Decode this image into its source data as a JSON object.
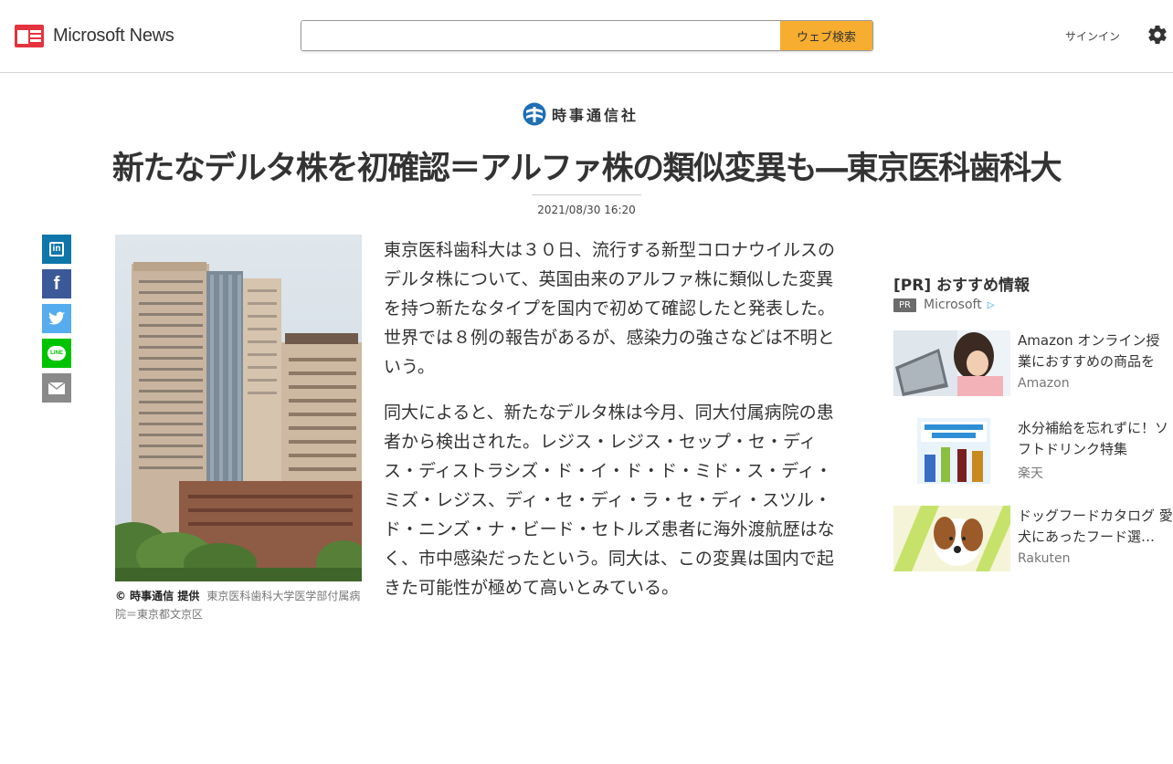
{
  "header": {
    "brand": "Microsoft News",
    "search_placeholder": "",
    "search_button": "ウェブ検索",
    "signin": "サインイン",
    "settings_icon": "gear-icon",
    "accent": "#f7ad2f"
  },
  "article": {
    "source": "時事通信社",
    "title": "新たなデルタ株を初確認＝アルファ株の類似変異も―東京医科歯科大",
    "datetime": "2021/08/30 16:20",
    "image_credit": "© 時事通信 提供",
    "image_caption": "東京医科歯科大学医学部付属病院＝東京都文京区",
    "paragraphs": [
      "東京医科歯科大は３０日、流行する新型コロナウイルスのデルタ株について、英国由来のアルファ株に類似した変異を持つ新たなタイプを国内で初めて確認したと発表した。世界では８例の報告があるが、感染力の強さなどは不明という。",
      "同大によると、新たなデルタ株は今月、同大付属病院の患者から検出された。レジス・レジス・セップ・セ・ディス・ディストラシズ・ド・イ・ド・ド・ミド・ス・ディ・ミズ・レジス、ディ・セ・ディ・ラ・セ・ディ・スツル・ド・ニンズ・ナ・ビード・セトルズ患者に海外渡航歴はなく、市中感染だったという。同大は、この変異は国内で起きた可能性が極めて高いとみている。"
    ]
  },
  "share": [
    {
      "name": "linkedin",
      "glyph": "in",
      "color": "#0e76a8"
    },
    {
      "name": "facebook",
      "glyph": "f",
      "color": "#3b5998"
    },
    {
      "name": "twitter",
      "glyph": "t",
      "color": "#55acee"
    },
    {
      "name": "line",
      "glyph": "LINE",
      "color": "#00c300"
    },
    {
      "name": "mail",
      "glyph": "✉",
      "color": "#8a8a8a"
    }
  ],
  "sidebar": {
    "heading": "[PR] おすすめ情報",
    "badge": "PR",
    "sponsor": "Microsoft",
    "items": [
      {
        "title": "Amazon オンライン授業におすすめの商品をチ…",
        "source": "Amazon"
      },
      {
        "title": "水分補給を忘れずに！ソフトドリンク特集",
        "source": "楽天"
      },
      {
        "title": "ドッグフードカタログ 愛犬にあったフード選…",
        "source": "Rakuten"
      }
    ]
  }
}
